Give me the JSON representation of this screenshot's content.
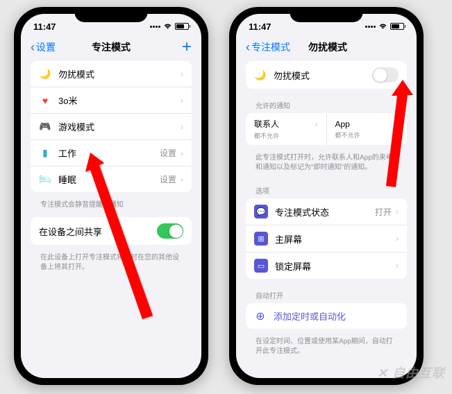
{
  "status": {
    "time": "11:47"
  },
  "phone1": {
    "nav": {
      "back": "设置",
      "title": "专注模式"
    },
    "modes": [
      {
        "icon": "🌙",
        "label": "勿扰模式",
        "value": ""
      },
      {
        "icon": "♥",
        "label": "3o米",
        "value": "",
        "iconColor": "#ff3b30"
      },
      {
        "icon": "🎮",
        "label": "游戏模式",
        "value": "",
        "iconColor": "#ff9500"
      },
      {
        "icon": "💼",
        "label": "工作",
        "value": "设置",
        "iconColor": "#5ac8fa"
      },
      {
        "icon": "🛏",
        "label": "睡眠",
        "value": "设置",
        "iconColor": "#5ac8fa"
      }
    ],
    "modes_footer": "专注模式会静音提醒和通知",
    "share": {
      "label": "在设备之间共享",
      "footer": "在此设备上打开专注模式将同时在您的其他设备上将其打开。"
    }
  },
  "phone2": {
    "nav": {
      "back": "专注模式",
      "title": "勿扰模式"
    },
    "dnd": {
      "label": "勿扰模式"
    },
    "allowed": {
      "header": "允许的通知",
      "contacts": "联系人",
      "apps": "App",
      "none": "都不允许",
      "footer": "此专注模式打开时，允许联系人和App的来电和通知以及标记为\"即时通知\"的通知。"
    },
    "options": {
      "header": "选项",
      "status": {
        "label": "专注模式状态",
        "value": "打开"
      },
      "home": {
        "label": "主屏幕"
      },
      "lock": {
        "label": "锁定屏幕"
      }
    },
    "auto": {
      "header": "自动打开",
      "add": "添加定时或自动化",
      "footer": "在设定时间、位置或使用某App期间，自动打开此专注模式。"
    }
  },
  "watermark": "自由互联"
}
